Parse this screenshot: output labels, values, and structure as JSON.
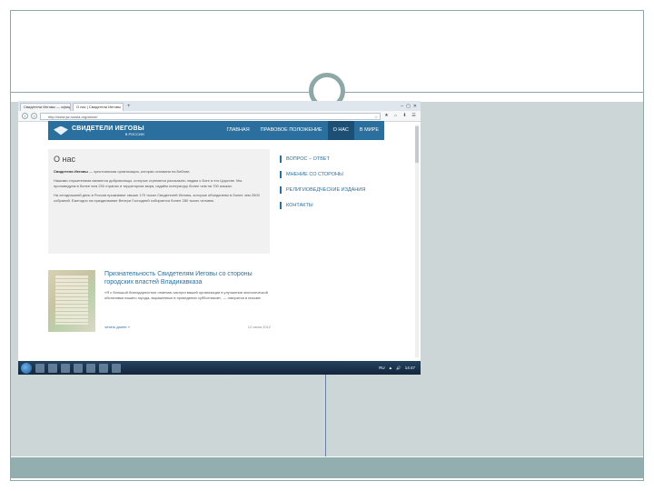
{
  "browser": {
    "tabs": [
      {
        "label": "Свидетели Иеговы — официальн…",
        "active": false
      },
      {
        "label": "О нас | Свидетели Иеговы",
        "active": true
      }
    ],
    "new_tab_symbol": "+",
    "window_controls": [
      "–",
      "▢",
      "✕"
    ],
    "back_symbol": "‹",
    "forward_symbol": "›",
    "url": "http://www.jw-russia.org/about/",
    "star_symbol": "☆",
    "toolbar_icons": [
      "★",
      "⌂",
      "⬇",
      "☰"
    ]
  },
  "site": {
    "logo_text": "СВИДЕТЕЛИ ИЕГОВЫ",
    "logo_sub": "В РОССИИ",
    "nav": [
      {
        "label": "ГЛАВНАЯ",
        "active": false
      },
      {
        "label": "ПРАВОВОЕ ПОЛОЖЕНИЕ",
        "active": false
      },
      {
        "label": "О НАС",
        "active": true
      },
      {
        "label": "В МИРЕ",
        "active": false
      }
    ],
    "about": {
      "title": "О нас",
      "lead_bold": "Свидетели Иеговы",
      "lead_rest": " — христианская организация, которая основана на Библии.",
      "p2": "Нашими служителями являются добровольцы, которые стремятся рассказать людям о Боге и его Царстве. Мы проповедуем в более чем 230 странах и территориях мира, издаём литературу более чем на 700 языках.",
      "p3": "На сегодняшний день в России проживают свыше 170 тысяч Свидетелей Иеговы, которые объединены в более чем 2500 собраний. Ежегодно на празднование Вечери Господней собирается более 280 тысяч человек."
    },
    "side_links": [
      "ВОПРОС – ОТВЕТ",
      "МНЕНИЕ СО СТОРОНЫ",
      "РЕЛИГИОВЕДЧЕСКИЕ ИЗДАНИЯ",
      "КОНТАКТЫ"
    ],
    "article": {
      "title": "Признательность Свидетелям Иеговы со стороны городских властей Владикавказа",
      "text": "«Я с большой благодарностью отмечаю заслуги вашей организации в улучшении экологической обстановки нашего города, выраженные в проведении субботников», — говорится в письме.",
      "more": "читать далее »",
      "date": "12 июля 2012"
    }
  },
  "taskbar": {
    "tray_items": [
      "RU",
      "▲",
      "🔊",
      "14:47"
    ]
  }
}
